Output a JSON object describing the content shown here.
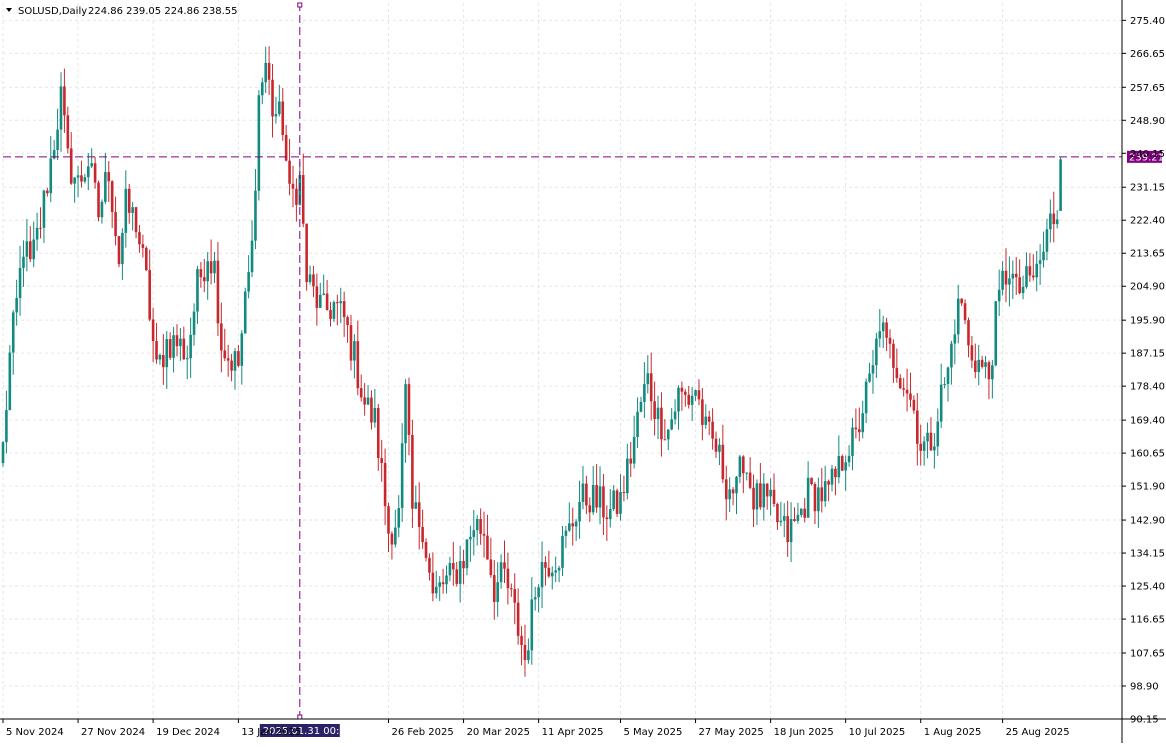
{
  "header": {
    "symbol": "SOLUSD,Daily",
    "ohlc": "224.86 239.05 224.86 238.55"
  },
  "colors": {
    "bull": "#138a7f",
    "bear": "#c8282d",
    "grid": "#e6e6e6",
    "crosshair": "#800080",
    "price_label_bg": "#800080",
    "axis_text": "#000000"
  },
  "crosshair": {
    "price_label": "239.21",
    "date_label": "2025.01.31 00:00",
    "price_value": 239.21,
    "date_value": "2025-01-31"
  },
  "chart_data": {
    "type": "candlestick",
    "title": "",
    "symbol": "SOLUSD",
    "timeframe": "Daily",
    "ylim": [
      90.15,
      280
    ],
    "xlim": [
      "2024-11-05",
      "2025-09-29"
    ],
    "grid": true,
    "y_ticks": [
      "275.40",
      "266.65",
      "257.65",
      "248.90",
      "240.15",
      "231.15",
      "222.40",
      "213.65",
      "204.90",
      "195.90",
      "187.15",
      "178.40",
      "169.40",
      "160.65",
      "151.90",
      "142.90",
      "134.15",
      "125.40",
      "116.65",
      "107.65",
      "98.90",
      "90.15"
    ],
    "x_ticks": [
      {
        "label": "5 Nov 2024",
        "date": "2024-11-05"
      },
      {
        "label": "27 Nov 2024",
        "date": "2024-11-27"
      },
      {
        "label": "19 Dec 2024",
        "date": "2024-12-19"
      },
      {
        "label": "13 Jan 2025",
        "date": "2025-01-13"
      },
      {
        "label": "26 Feb 2025",
        "date": "2025-02-26"
      },
      {
        "label": "20 Mar 2025",
        "date": "2025-03-20"
      },
      {
        "label": "11 Apr 2025",
        "date": "2025-04-11"
      },
      {
        "label": "5 May 2025",
        "date": "2025-05-05"
      },
      {
        "label": "27 May 2025",
        "date": "2025-05-27"
      },
      {
        "label": "18 Jun 2025",
        "date": "2025-06-18"
      },
      {
        "label": "10 Jul 2025",
        "date": "2025-07-10"
      },
      {
        "label": "1 Aug 2025",
        "date": "2025-08-01"
      },
      {
        "label": "25 Aug 2025",
        "date": "2025-08-25"
      }
    ],
    "anchors": [
      [
        "2024-11-05",
        162
      ],
      [
        "2024-11-07",
        186
      ],
      [
        "2024-11-09",
        200
      ],
      [
        "2024-11-11",
        216
      ],
      [
        "2024-11-13",
        210
      ],
      [
        "2024-11-16",
        222
      ],
      [
        "2024-11-19",
        238
      ],
      [
        "2024-11-22",
        255
      ],
      [
        "2024-11-24",
        238
      ],
      [
        "2024-11-27",
        232
      ],
      [
        "2024-11-30",
        238
      ],
      [
        "2024-12-03",
        224
      ],
      [
        "2024-12-06",
        236
      ],
      [
        "2024-12-09",
        212
      ],
      [
        "2024-12-11",
        226
      ],
      [
        "2024-12-14",
        222
      ],
      [
        "2024-12-17",
        206
      ],
      [
        "2024-12-20",
        182
      ],
      [
        "2024-12-23",
        190
      ],
      [
        "2024-12-26",
        190
      ],
      [
        "2024-12-29",
        187
      ],
      [
        "2025-01-01",
        205
      ],
      [
        "2025-01-04",
        214
      ],
      [
        "2025-01-06",
        210
      ],
      [
        "2025-01-08",
        190
      ],
      [
        "2025-01-10",
        186
      ],
      [
        "2025-01-13",
        184
      ],
      [
        "2025-01-15",
        200
      ],
      [
        "2025-01-17",
        215
      ],
      [
        "2025-01-19",
        255
      ],
      [
        "2025-01-21",
        264
      ],
      [
        "2025-01-23",
        252
      ],
      [
        "2025-01-26",
        248
      ],
      [
        "2025-01-28",
        228
      ],
      [
        "2025-01-31",
        233
      ],
      [
        "2025-02-02",
        207
      ],
      [
        "2025-02-04",
        203
      ],
      [
        "2025-02-07",
        198
      ],
      [
        "2025-02-10",
        200
      ],
      [
        "2025-02-13",
        196
      ],
      [
        "2025-02-16",
        186
      ],
      [
        "2025-02-19",
        174
      ],
      [
        "2025-02-22",
        169
      ],
      [
        "2025-02-24",
        155
      ],
      [
        "2025-02-26",
        140
      ],
      [
        "2025-03-01",
        144
      ],
      [
        "2025-03-03",
        176
      ],
      [
        "2025-03-05",
        145
      ],
      [
        "2025-03-08",
        142
      ],
      [
        "2025-03-11",
        122
      ],
      [
        "2025-03-14",
        126
      ],
      [
        "2025-03-17",
        128
      ],
      [
        "2025-03-20",
        133
      ],
      [
        "2025-03-23",
        142
      ],
      [
        "2025-03-26",
        140
      ],
      [
        "2025-03-29",
        125
      ],
      [
        "2025-04-01",
        128
      ],
      [
        "2025-04-04",
        118
      ],
      [
        "2025-04-07",
        106
      ],
      [
        "2025-04-09",
        118
      ],
      [
        "2025-04-11",
        130
      ],
      [
        "2025-04-14",
        132
      ],
      [
        "2025-04-17",
        134
      ],
      [
        "2025-04-20",
        140
      ],
      [
        "2025-04-23",
        148
      ],
      [
        "2025-04-26",
        149
      ],
      [
        "2025-04-29",
        147
      ],
      [
        "2025-05-02",
        145
      ],
      [
        "2025-05-05",
        148
      ],
      [
        "2025-05-08",
        160
      ],
      [
        "2025-05-11",
        174
      ],
      [
        "2025-05-13",
        180
      ],
      [
        "2025-05-16",
        170
      ],
      [
        "2025-05-19",
        167
      ],
      [
        "2025-05-22",
        176
      ],
      [
        "2025-05-25",
        175
      ],
      [
        "2025-05-27",
        178
      ],
      [
        "2025-05-30",
        166
      ],
      [
        "2025-06-02",
        162
      ],
      [
        "2025-06-05",
        153
      ],
      [
        "2025-06-08",
        150
      ],
      [
        "2025-06-10",
        160
      ],
      [
        "2025-06-13",
        149
      ],
      [
        "2025-06-16",
        148
      ],
      [
        "2025-06-18",
        146
      ],
      [
        "2025-06-21",
        141
      ],
      [
        "2025-06-23",
        139
      ],
      [
        "2025-06-26",
        143
      ],
      [
        "2025-06-29",
        150
      ],
      [
        "2025-07-02",
        150
      ],
      [
        "2025-07-05",
        150
      ],
      [
        "2025-07-08",
        156
      ],
      [
        "2025-07-10",
        162
      ],
      [
        "2025-07-13",
        164
      ],
      [
        "2025-07-15",
        173
      ],
      [
        "2025-07-18",
        182
      ],
      [
        "2025-07-20",
        196
      ],
      [
        "2025-07-22",
        188
      ],
      [
        "2025-07-24",
        186
      ],
      [
        "2025-07-26",
        182
      ],
      [
        "2025-07-28",
        178
      ],
      [
        "2025-07-30",
        172
      ],
      [
        "2025-08-01",
        163
      ],
      [
        "2025-08-03",
        162
      ],
      [
        "2025-08-05",
        167
      ],
      [
        "2025-08-07",
        176
      ],
      [
        "2025-08-09",
        182
      ],
      [
        "2025-08-11",
        196
      ],
      [
        "2025-08-13",
        201
      ],
      [
        "2025-08-15",
        188
      ],
      [
        "2025-08-17",
        186
      ],
      [
        "2025-08-19",
        183
      ],
      [
        "2025-08-21",
        181
      ],
      [
        "2025-08-23",
        196
      ],
      [
        "2025-08-25",
        206
      ],
      [
        "2025-08-27",
        210
      ],
      [
        "2025-08-29",
        203
      ],
      [
        "2025-08-31",
        205
      ],
      [
        "2025-09-02",
        206
      ],
      [
        "2025-09-04",
        209
      ],
      [
        "2025-09-06",
        214
      ],
      [
        "2025-09-08",
        222
      ],
      [
        "2025-09-10",
        225
      ],
      [
        "2025-09-11",
        238.55
      ]
    ]
  }
}
